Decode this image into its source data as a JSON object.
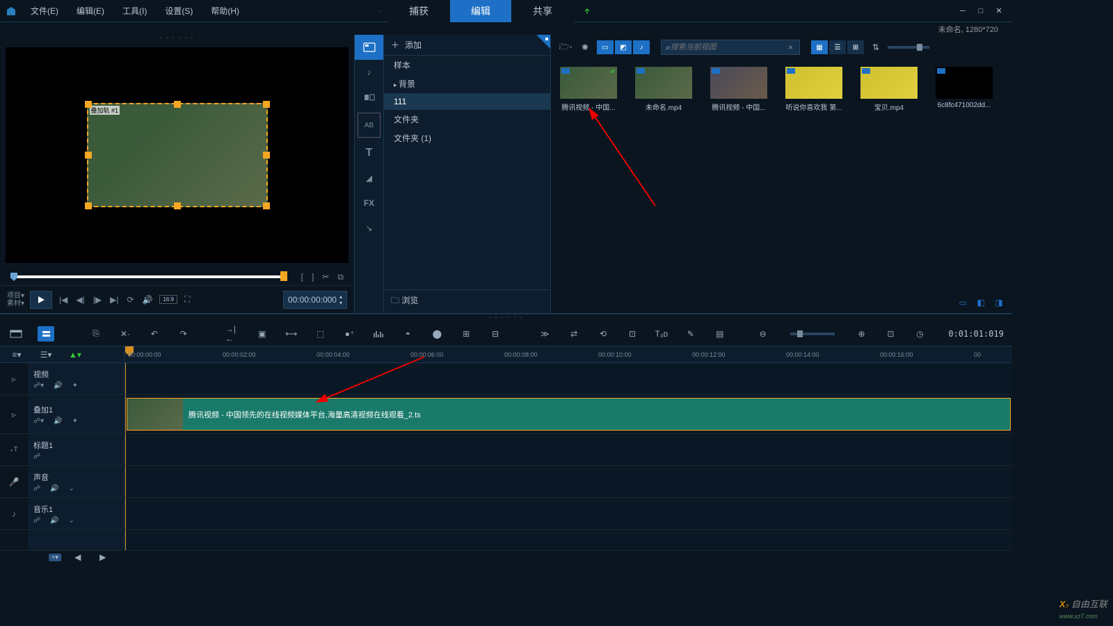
{
  "menu": {
    "file": "文件(E)",
    "edit": "编辑(E)",
    "tool": "工具(I)",
    "settings": "设置(S)",
    "help": "帮助(H)"
  },
  "topTabs": {
    "capture": "捕获",
    "edit": "编辑",
    "share": "共享"
  },
  "projectInfo": "未命名, 1280*720",
  "preview": {
    "overlayLabel": "叠加轨 #1",
    "timecode": "00:00:00:000",
    "projLabel1": "项目▾",
    "projLabel2": "素材▾",
    "aspectRatio": "16:9"
  },
  "library": {
    "add": "添加",
    "tree": {
      "sample": "样本",
      "background": "背景",
      "folder111": "111",
      "folderA": "文件夹",
      "folderB": "文件夹 (1)"
    },
    "browse": "浏览",
    "searchPlaceholder": "搜索当前视图"
  },
  "media": [
    {
      "name": "腾讯视频 - 中国..."
    },
    {
      "name": "未命名.mp4"
    },
    {
      "name": "腾讯视频 - 中国..."
    },
    {
      "name": "听说你喜欢我 第..."
    },
    {
      "name": "宝贝.mp4"
    },
    {
      "name": "6c8fc471002dd..."
    }
  ],
  "timeline": {
    "timecode": "0:01:01:019",
    "ruler": [
      "00:00:00:00",
      "00:00:02:00",
      "00:00:04:00",
      "00:00:06:00",
      "00:00:08:00",
      "00:00:10:00",
      "00:00:12:00",
      "00:00:14:00",
      "00:00:16:00",
      "00"
    ],
    "tracks": {
      "video": "视频",
      "overlay": "叠加1",
      "title": "标题1",
      "voice": "声音",
      "music": "音乐1"
    },
    "clipLabel": "腾讯视频 - 中国领先的在线视频媒体平台,海量高清视频在线观看_2.ts"
  },
  "watermark": {
    "brand": "自由互联",
    "url": "www.xz7.com"
  }
}
